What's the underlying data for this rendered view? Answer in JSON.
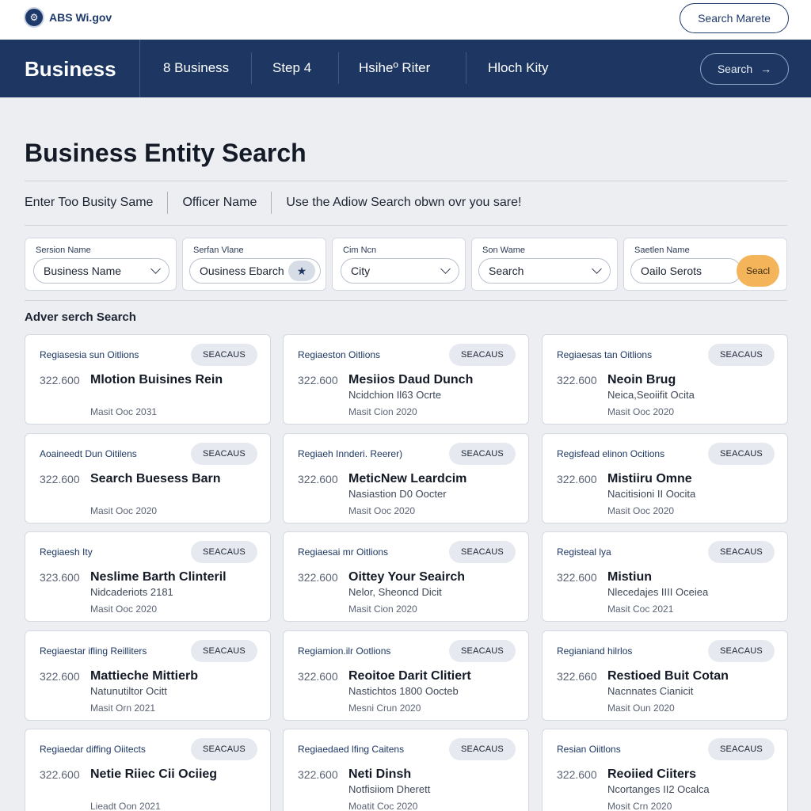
{
  "header": {
    "brand": "ABS Wi.gov",
    "top_button": "Search Marete"
  },
  "nav": {
    "title": "Business",
    "items": [
      "8 Business",
      "Step 4",
      "Hsiheº Riter",
      "Hloch Kity"
    ],
    "search_button": "Search"
  },
  "page": {
    "title": "Business Entity Search",
    "tabs": [
      "Enter Too Busity Same",
      "Officer Name",
      "Use the Adiow Search obwn  ovr you sare!"
    ]
  },
  "filters": [
    {
      "label": "Sersion Name",
      "value": "Business Name"
    },
    {
      "label": "Serfan Vlane",
      "value": "Ousiness Ebarch"
    },
    {
      "label": "Cim Ncn",
      "value": "City"
    },
    {
      "label": "Son Wame",
      "value": "Search"
    },
    {
      "label": "Saetlen Name",
      "value": "Oailo Serots"
    }
  ],
  "filter_go_button": "Seacl",
  "section_label": "Adver serch Search",
  "cards": [
    {
      "category": "Regiasesia sun Oitlions",
      "badge": "SEACAUS",
      "number": "322.600",
      "name": "Mlotion Buisines Rein",
      "sub": "",
      "date": "Masit Ooc 2031"
    },
    {
      "category": "Regiaeston Oitlions",
      "badge": "SEACAUS",
      "number": "322.600",
      "name": "Mesiios Daud Dunch",
      "sub": "Ncidchion Il63 Ocrte",
      "date": "Masit Cion 2020"
    },
    {
      "category": "Regiaesas tan Oitlions",
      "badge": "SEACAUS",
      "number": "322.600",
      "name": "Neoin Brug",
      "sub": "Neica,Seoiifit Ocita",
      "date": "Masit Ooc 2020"
    },
    {
      "category": "Aoaineedt Dun Oitilens",
      "badge": "SEACAUS",
      "number": "322.600",
      "name": "Search Buesess Barn",
      "sub": "",
      "date": "Masit Ooc 2020"
    },
    {
      "category": "Regiaeh Innderi. Reerer)",
      "badge": "SEACAUS",
      "number": "322.600",
      "name": "MeticNew Leardcim",
      "sub": "Nasiastion D0 Oocter",
      "date": "Masit Ooc 2020"
    },
    {
      "category": "Regisfead elinon Ocitions",
      "badge": "SEACAUS",
      "number": "322.600",
      "name": "Mistiiru Omne",
      "sub": "Nacitisioni II Oocita",
      "date": "Masit Ooc 2020"
    },
    {
      "category": "Regiaesh Ity",
      "badge": "SEACAUS",
      "number": "323.600",
      "name": "Neslime Barth Clinteril",
      "sub": "Nidcaderiots 2181",
      "date": "Masit Ooc 2020"
    },
    {
      "category": "Regiaesai mr Oitlions",
      "badge": "SEACAUS",
      "number": "322.600",
      "name": "Oittey Your Seairch",
      "sub": "Nelor, Sheoncd Dicit",
      "date": "Masit Cion 2020"
    },
    {
      "category": "Registeal lya",
      "badge": "SEACAUS",
      "number": "322.600",
      "name": "Mistiun",
      "sub": "Nlecedajes IIII Oceiea",
      "date": "Masit Coc 2021"
    },
    {
      "category": "Regiaestar ifling Reilliters",
      "badge": "SEACAUS",
      "number": "322.600",
      "name": "Mattieche Mittierb",
      "sub": "Natunutiltor Ocitt",
      "date": "Masit Orn 2021"
    },
    {
      "category": "Regiamion.ilr Ootlions",
      "badge": "SEACAUS",
      "number": "322.600",
      "name": "Reoitoe Darit Clitiert",
      "sub": "Nastichtos 1800 Oocteb",
      "date": "Mesni Crun 2020"
    },
    {
      "category": "Regianiand hilrlos",
      "badge": "SEACAUS",
      "number": "322.660",
      "name": "Restioed Buit Cotan",
      "sub": "Nacnnates Cianicit",
      "date": "Masit Oun 2020"
    },
    {
      "category": "Regiaedar diffing Oiitects",
      "badge": "SEACAUS",
      "number": "322.600",
      "name": "Netie Riiec Cii Ociieg",
      "sub": "",
      "date": "Lieadt Oon 2021"
    },
    {
      "category": "Regiaedaed lfing Caitens",
      "badge": "SEACAUS",
      "number": "322.600",
      "name": "Neti Dinsh",
      "sub": "Notfisiiom Dherett",
      "date": "Moatit Coc 2020"
    },
    {
      "category": "Resian Oiitlons",
      "badge": "SEACAUS",
      "number": "322.600",
      "name": "Reoiied Ciiters",
      "sub": "Ncortanges II2 Ocalca",
      "date": "Mosit Crn 2020"
    }
  ]
}
